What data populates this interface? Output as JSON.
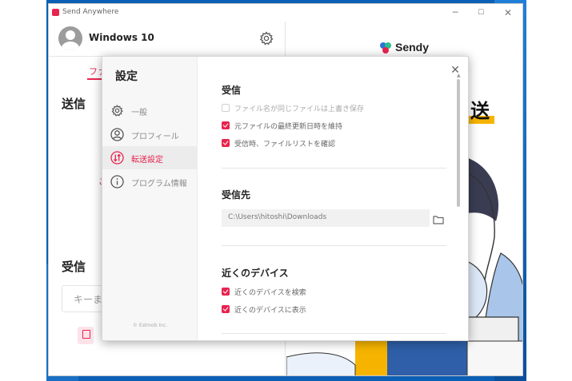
{
  "window": {
    "title": "Send Anywhere"
  },
  "main": {
    "device_name": "Windows 10",
    "tab_label": "ファ",
    "send_heading": "送信",
    "send_hint": "こ",
    "receive_heading": "受信",
    "key_input_placeholder": "キーま"
  },
  "right_panel": {
    "brand": "Sendy",
    "big_text": "送"
  },
  "settings": {
    "title": "設定",
    "nav": [
      {
        "label": "一般",
        "icon": "gear-icon",
        "active": false
      },
      {
        "label": "プロフィール",
        "icon": "person-icon",
        "active": false
      },
      {
        "label": "転送設定",
        "icon": "transfer-icon",
        "active": true
      },
      {
        "label": "プログラム情報",
        "icon": "info-icon",
        "active": false
      }
    ],
    "copyright": "© Estmob Inc.",
    "sections": {
      "receive": {
        "title": "受信",
        "options": [
          {
            "label": "ファイル名が同じファイルは上書き保存",
            "checked": false
          },
          {
            "label": "元ファイルの最終更新日時を維持",
            "checked": true
          },
          {
            "label": "受信時、ファイルリストを確認",
            "checked": true
          }
        ]
      },
      "destination": {
        "title": "受信先",
        "path": "C:\\Users\\hitoshi\\Downloads"
      },
      "nearby": {
        "title": "近くのデバイス",
        "options": [
          {
            "label": "近くのデバイスを検索",
            "checked": true
          },
          {
            "label": "近くのデバイスに表示",
            "checked": true
          }
        ]
      }
    }
  },
  "colors": {
    "accent": "#e8244f",
    "wallpaper": "#0b5fb5",
    "highlight": "#f6b400"
  }
}
